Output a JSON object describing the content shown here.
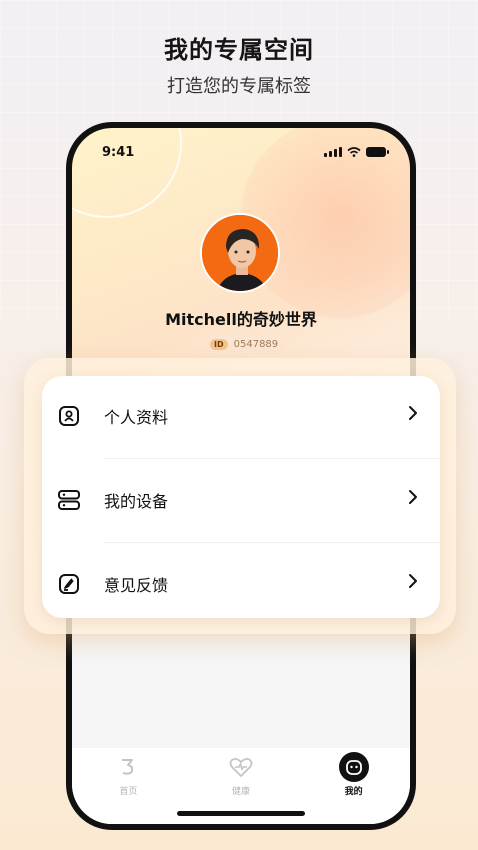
{
  "promo": {
    "headline": "我的专属空间",
    "subheadline": "打造您的专属标签"
  },
  "status_bar": {
    "time": "9:41"
  },
  "profile": {
    "username": "Mitchell的奇妙世界",
    "id_tag": "ID",
    "id_value": "0547889"
  },
  "menu": {
    "items": [
      {
        "label": "个人资料",
        "icon": "profile-card-icon"
      },
      {
        "label": "我的设备",
        "icon": "device-icon"
      },
      {
        "label": "意见反馈",
        "icon": "feedback-icon"
      }
    ]
  },
  "tabbar": {
    "tabs": [
      {
        "label": "首页",
        "icon": "home-icon",
        "active": false
      },
      {
        "label": "健康",
        "icon": "heart-pulse-icon",
        "active": false
      },
      {
        "label": "我的",
        "icon": "mine-face-icon",
        "active": true
      }
    ]
  },
  "colors": {
    "accent": "#f36a12",
    "text": "#111111",
    "inactive": "#b5b5b5",
    "card_frame": "#fff0dc"
  }
}
